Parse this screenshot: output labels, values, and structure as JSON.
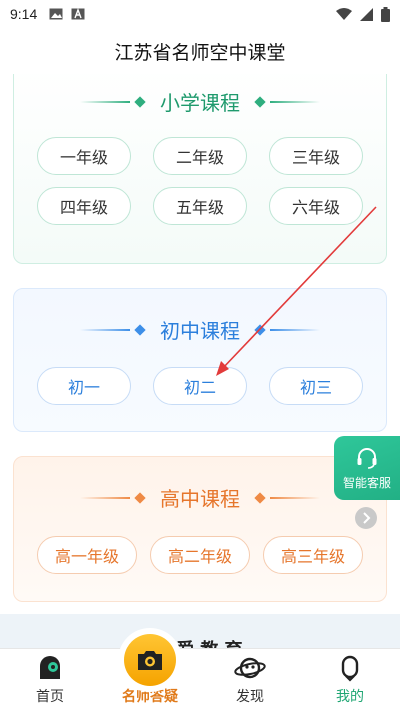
{
  "status_bar": {
    "time": "9:14",
    "icons": [
      "image-icon",
      "a-icon",
      "wifi-icon",
      "signal-icon",
      "battery-icon"
    ]
  },
  "header": {
    "title": "江苏省名师空中课堂"
  },
  "primary_card": {
    "heading": "小学课程",
    "grades": [
      "一年级",
      "二年级",
      "三年级",
      "四年级",
      "五年级",
      "六年级"
    ],
    "accent": "#2fae7f"
  },
  "middle_card": {
    "heading": "初中课程",
    "grades": [
      "初一",
      "初二",
      "初三"
    ],
    "accent": "#3d8fe8"
  },
  "high_card": {
    "heading": "高中课程",
    "grades": [
      "高一年级",
      "高二年级",
      "高三年级"
    ],
    "accent": "#ef8a45"
  },
  "floating_service": {
    "label": "智能客服"
  },
  "peek_section": {
    "text": "爱 教 育"
  },
  "tab_bar": {
    "tabs": [
      {
        "label": "首页",
        "icon": "home-icon"
      },
      {
        "label": "名师答疑",
        "icon": "camera-icon"
      },
      {
        "label": "发现",
        "icon": "planet-icon"
      },
      {
        "label": "我的",
        "icon": "profile-icon"
      }
    ]
  },
  "annotation": {
    "color": "#e23b3b",
    "target": "初二"
  }
}
